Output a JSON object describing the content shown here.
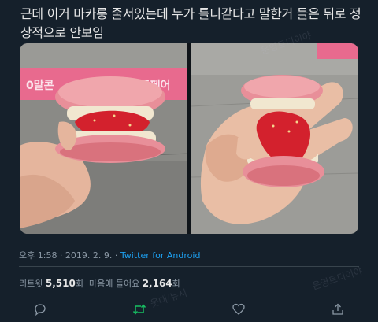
{
  "tweet": {
    "text": "근데 이거 마카룽 줄서있는데 누가 틀니같다고 말한거 들은 뒤로 정상적으로 안보임",
    "time": "오후 1:58 · 2019. 2. 9. · ",
    "source": "Twitter for Android"
  },
  "photos": {
    "left_sign_text_1": "0말콘",
    "left_sign_text_2": "저트페어"
  },
  "stats": {
    "retweets_label": "리트윗",
    "retweets_count": "5,510",
    "retweets_unit": "회",
    "likes_label": "마음에 들어요",
    "likes_count": "2,164",
    "likes_unit": "회"
  },
  "watermark": {
    "text_1": "웃대/뉴시",
    "text_2": "운영트디이야"
  },
  "icons": [
    "reply-icon",
    "retweet-icon",
    "like-icon",
    "share-icon"
  ],
  "colors": {
    "background": "#15202b",
    "link": "#1da1f2",
    "retweet_active": "#17bf63"
  }
}
